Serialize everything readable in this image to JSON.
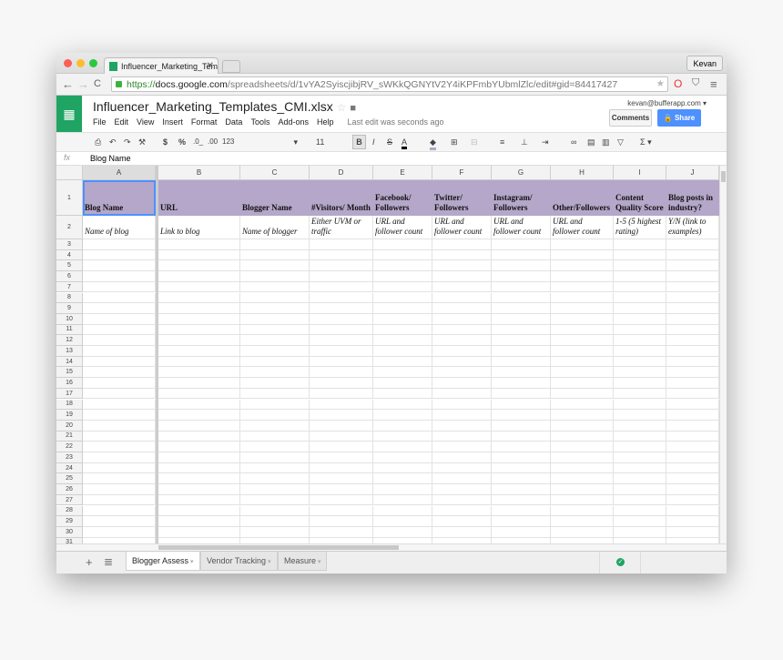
{
  "browser": {
    "tab_title": "Influencer_Marketing_Temp",
    "user": "Kevan",
    "url_scheme": "https://",
    "url_domain": "docs.google.com",
    "url_path": "/spreadsheets/d/1vYA2SyiscjibjRV_sWKkQGNYtV2Y4iKPFmbYUbmlZlc/edit#gid=84417427"
  },
  "app": {
    "title": "Influencer_Marketing_Templates_CMI.xlsx",
    "email": "kevan@bufferapp.com",
    "comments": "Comments",
    "share": "Share",
    "last_edit": "Last edit was seconds ago",
    "menu": [
      "File",
      "Edit",
      "View",
      "Insert",
      "Format",
      "Data",
      "Tools",
      "Add-ons",
      "Help"
    ]
  },
  "toolbar": {
    "currency": "$",
    "percent": "%",
    "dec_less": ".0_",
    "dec_more": ".00",
    "number_format": "123",
    "font_size": "11",
    "bold": "B",
    "italic": "I",
    "strike": "S",
    "text_color": "A"
  },
  "formula_bar": {
    "fx": "fx",
    "value": "Blog Name"
  },
  "columns": [
    "A",
    "B",
    "C",
    "D",
    "E",
    "F",
    "G",
    "H",
    "I",
    "J"
  ],
  "header_row": [
    "Blog Name",
    "URL",
    "Blogger Name",
    "#Visitors/ Month",
    "Facebook/ Followers",
    "Twitter/ Followers",
    "Instagram/ Followers",
    "Other/Followers",
    "Content Quality Score",
    "Blog posts in industry?"
  ],
  "row2": [
    "Name of blog",
    "Link to blog",
    "Name of blogger",
    "Either UVM or traffic",
    "URL and follower count",
    "URL and follower count",
    "URL and follower count",
    "URL and follower count",
    "1-5 (5 highest rating)",
    "Y/N (link to examples)"
  ],
  "row_numbers": [
    "1",
    "2",
    "3",
    "4",
    "5",
    "6",
    "7",
    "8",
    "9",
    "10",
    "11",
    "12",
    "13",
    "14",
    "15",
    "16",
    "17",
    "18",
    "19",
    "20",
    "21",
    "22",
    "23",
    "24",
    "25",
    "26",
    "27",
    "28",
    "29",
    "30",
    "31"
  ],
  "sheets": [
    {
      "label": "Blogger Assess",
      "active": true
    },
    {
      "label": "Vendor Tracking",
      "active": false
    },
    {
      "label": "Measure",
      "active": false
    }
  ],
  "colors": {
    "header_fill": "#b4a7c9",
    "brand": "#1fa463",
    "share": "#4d90fe"
  }
}
